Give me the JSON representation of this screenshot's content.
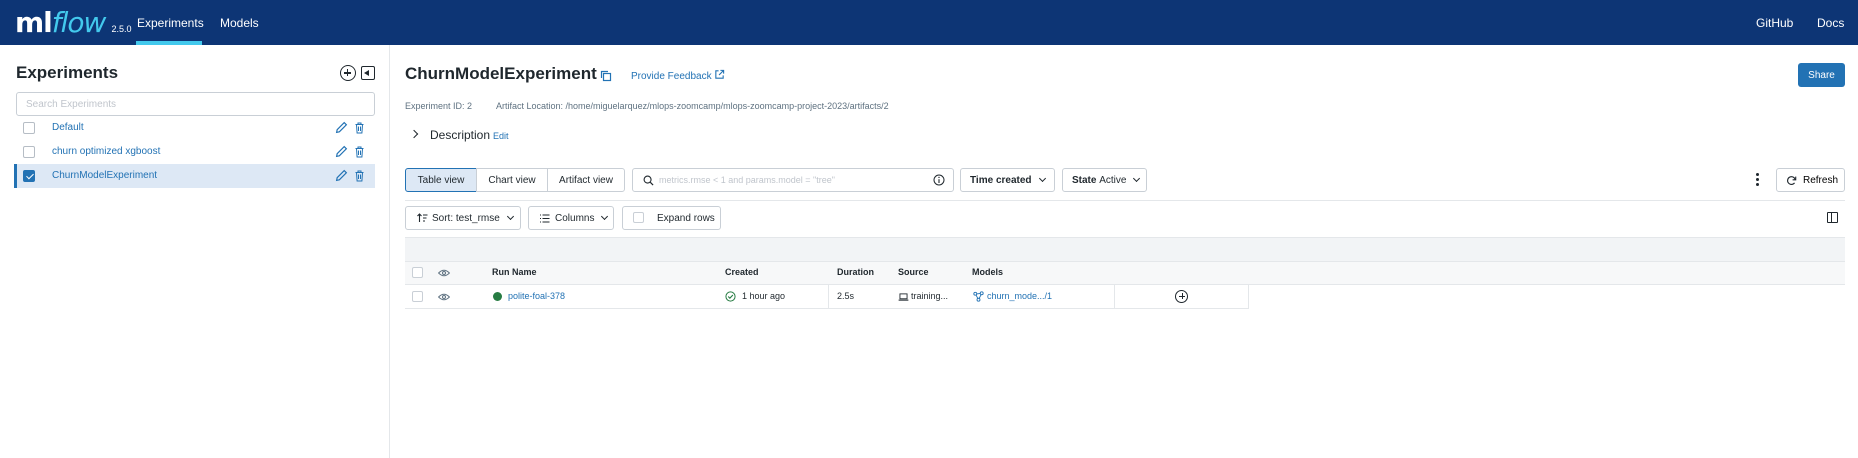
{
  "header": {
    "logo_ml": "ml",
    "logo_flow": "flow",
    "version": "2.5.0",
    "nav": [
      "Experiments",
      "Models"
    ],
    "right_links": [
      "GitHub",
      "Docs"
    ],
    "bg_color": "#0d3575",
    "accent_color": "#43c9ed"
  },
  "sidebar": {
    "title": "Experiments",
    "search_placeholder": "Search Experiments",
    "experiments": [
      {
        "name": "Default",
        "checked": false
      },
      {
        "name": "churn optimized xgboost",
        "checked": false
      },
      {
        "name": "ChurnModelExperiment",
        "checked": true,
        "selected": true
      }
    ]
  },
  "experiment": {
    "title": "ChurnModelExperiment",
    "feedback_label": "Provide Feedback",
    "share_label": "Share",
    "id_label": "Experiment ID: 2",
    "artifact_label": "Artifact Location: /home/miguelarquez/mlops-zoomcamp/mlops-zoomcamp-project-2023/artifacts/2",
    "description_label": "Description",
    "description_edit": "Edit"
  },
  "toolbar": {
    "views": [
      "Table view",
      "Chart view",
      "Artifact view"
    ],
    "active_view": "Table view",
    "filter_placeholder": "metrics.rmse < 1 and params.model = \"tree\"",
    "time_created_label": "Time created",
    "state_label": "State",
    "state_value": "Active",
    "refresh_label": "Refresh",
    "sort_label": "Sort: test_rmse",
    "columns_label": "Columns",
    "expand_label": "Expand rows"
  },
  "table": {
    "columns": [
      "Run Name",
      "Created",
      "Duration",
      "Source",
      "Models"
    ],
    "rows": [
      {
        "run_name": "polite-foal-378",
        "created": "1 hour ago",
        "duration": "2.5s",
        "source": "training...",
        "models": "churn_mode.../1",
        "status_color": "#277c43"
      }
    ]
  }
}
